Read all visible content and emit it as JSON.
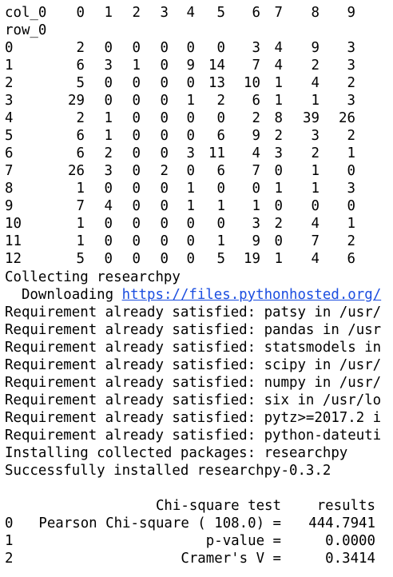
{
  "crosstab": {
    "col_header_label": "col_0",
    "row_header_label": "row_0",
    "columns": [
      "0",
      "1",
      "2",
      "3",
      "4",
      "5",
      "6",
      "7",
      "8",
      "9"
    ],
    "rows": [
      {
        "label": "0",
        "cells": [
          "2",
          "0",
          "0",
          "0",
          "0",
          "0",
          "3",
          "4",
          "9",
          "3"
        ]
      },
      {
        "label": "1",
        "cells": [
          "6",
          "3",
          "1",
          "0",
          "9",
          "14",
          "7",
          "4",
          "2",
          "3"
        ]
      },
      {
        "label": "2",
        "cells": [
          "5",
          "0",
          "0",
          "0",
          "0",
          "13",
          "10",
          "1",
          "4",
          "2"
        ]
      },
      {
        "label": "3",
        "cells": [
          "29",
          "0",
          "0",
          "0",
          "1",
          "2",
          "6",
          "1",
          "1",
          "3"
        ]
      },
      {
        "label": "4",
        "cells": [
          "2",
          "1",
          "0",
          "0",
          "0",
          "0",
          "2",
          "8",
          "39",
          "26"
        ]
      },
      {
        "label": "5",
        "cells": [
          "6",
          "1",
          "0",
          "0",
          "0",
          "6",
          "9",
          "2",
          "3",
          "2"
        ]
      },
      {
        "label": "6",
        "cells": [
          "6",
          "2",
          "0",
          "0",
          "3",
          "11",
          "4",
          "3",
          "2",
          "1"
        ]
      },
      {
        "label": "7",
        "cells": [
          "26",
          "3",
          "0",
          "2",
          "0",
          "6",
          "7",
          "0",
          "1",
          "0"
        ]
      },
      {
        "label": "8",
        "cells": [
          "1",
          "0",
          "0",
          "0",
          "1",
          "0",
          "0",
          "1",
          "1",
          "3"
        ]
      },
      {
        "label": "9",
        "cells": [
          "7",
          "4",
          "0",
          "0",
          "1",
          "1",
          "1",
          "0",
          "0",
          "0"
        ]
      },
      {
        "label": "10",
        "cells": [
          "1",
          "0",
          "0",
          "0",
          "0",
          "0",
          "3",
          "2",
          "4",
          "1"
        ]
      },
      {
        "label": "11",
        "cells": [
          "1",
          "0",
          "0",
          "0",
          "0",
          "1",
          "9",
          "0",
          "7",
          "2"
        ]
      },
      {
        "label": "12",
        "cells": [
          "5",
          "0",
          "0",
          "0",
          "0",
          "5",
          "19",
          "1",
          "4",
          "6"
        ]
      }
    ]
  },
  "pip_output": {
    "collecting": "Collecting researchpy",
    "downloading_prefix": "  Downloading ",
    "downloading_link": "https://files.pythonhosted.org/",
    "requirements": [
      "Requirement already satisfied: patsy in /usr/",
      "Requirement already satisfied: pandas in /usr",
      "Requirement already satisfied: statsmodels in",
      "Requirement already satisfied: scipy in /usr/",
      "Requirement already satisfied: numpy in /usr/",
      "Requirement already satisfied: six in /usr/lo",
      "Requirement already satisfied: pytz>=2017.2 i",
      "Requirement already satisfied: python-dateuti"
    ],
    "installing": "Installing collected packages: researchpy",
    "success": "Successfully installed researchpy-0.3.2"
  },
  "results_table": {
    "header_test": "Chi-square test",
    "header_results": "results",
    "rows": [
      {
        "index": "0",
        "test": "Pearson Chi-square ( 108.0) =",
        "result": "444.7941"
      },
      {
        "index": "1",
        "test": "p-value =",
        "result": "0.0000"
      },
      {
        "index": "2",
        "test": "Cramer's V =",
        "result": "0.3414"
      }
    ]
  }
}
